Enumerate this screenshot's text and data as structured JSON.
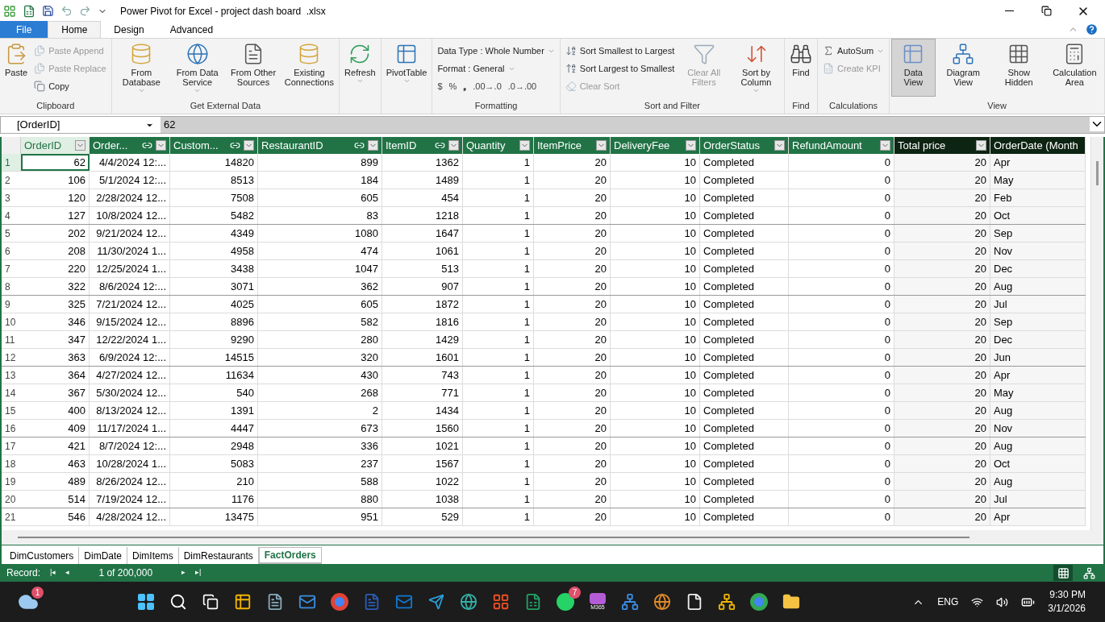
{
  "window": {
    "title": "Power Pivot for Excel - project dash board  .xlsx"
  },
  "ribbon_tabs": [
    {
      "label": "File",
      "kind": "file",
      "selected": false
    },
    {
      "label": "Home",
      "kind": "tab",
      "selected": true
    },
    {
      "label": "Design",
      "kind": "tab",
      "selected": false
    },
    {
      "label": "Advanced",
      "kind": "tab",
      "selected": false
    }
  ],
  "ribbon_groups": [
    {
      "label": "Clipboard",
      "items": [
        {
          "kind": "large",
          "label": "Paste",
          "disabled": false
        },
        {
          "kind": "stack",
          "items": [
            {
              "label": "Paste Append",
              "disabled": true
            },
            {
              "label": "Paste Replace",
              "disabled": true
            },
            {
              "label": "Copy",
              "disabled": false
            }
          ]
        }
      ]
    },
    {
      "label": "Get External Data",
      "items": [
        {
          "kind": "large",
          "label": "From Database",
          "dropdown": true,
          "disabled": false
        },
        {
          "kind": "large",
          "label": "From Data Service",
          "dropdown": true,
          "disabled": false
        },
        {
          "kind": "large",
          "label": "From Other Sources",
          "disabled": false
        },
        {
          "kind": "large",
          "label": "Existing Connections",
          "disabled": false
        }
      ]
    },
    {
      "items": [
        {
          "kind": "large",
          "label": "Refresh",
          "dropdown": true,
          "disabled": false
        }
      ]
    },
    {
      "items": [
        {
          "kind": "large",
          "label": "PivotTable",
          "dropdown": true,
          "disabled": false
        }
      ]
    },
    {
      "label": "Formatting",
      "items": [
        {
          "kind": "format",
          "data_type": "Data Type : Whole Number",
          "format": "Format : General",
          "symbols": [
            "$",
            "%",
            "❟",
            ".00→.0",
            ".0→.00"
          ]
        }
      ]
    },
    {
      "label": "Sort and Filter",
      "items": [
        {
          "kind": "stack",
          "items": [
            {
              "label": "Sort Smallest to Largest",
              "disabled": false
            },
            {
              "label": "Sort Largest to Smallest",
              "disabled": false
            },
            {
              "label": "Clear Sort",
              "disabled": true
            }
          ]
        },
        {
          "kind": "large",
          "label": "Clear All Filters",
          "disabled": true
        },
        {
          "kind": "large",
          "label": "Sort by Column",
          "dropdown": true,
          "disabled": false
        }
      ]
    },
    {
      "label": "Find",
      "items": [
        {
          "kind": "large",
          "label": "Find",
          "disabled": false
        }
      ]
    },
    {
      "label": "Calculations",
      "items": [
        {
          "kind": "stack",
          "items": [
            {
              "label": "AutoSum",
              "disabled": false,
              "dropdown": true
            },
            {
              "label": "Create KPI",
              "disabled": true
            }
          ]
        }
      ]
    },
    {
      "label": "View",
      "items": [
        {
          "kind": "large",
          "label": "Data View",
          "disabled": false,
          "selected": true
        },
        {
          "kind": "large",
          "label": "Diagram View",
          "disabled": false,
          "selected": false
        },
        {
          "kind": "large",
          "label": "Show Hidden",
          "disabled": false,
          "selected": false
        },
        {
          "kind": "large",
          "label": "Calculation Area",
          "disabled": false,
          "selected": false
        }
      ]
    }
  ],
  "formula_bar": {
    "name_box": "[OrderID]",
    "value": "62"
  },
  "table": {
    "columns": [
      {
        "label": "OrderID",
        "kind": "number",
        "selected": true,
        "linked": false,
        "calculated": false
      },
      {
        "label": "Order...",
        "kind": "number",
        "selected": false,
        "linked": true,
        "calculated": false
      },
      {
        "label": "Custom...",
        "kind": "number",
        "selected": false,
        "linked": true,
        "calculated": false
      },
      {
        "label": "RestaurantID",
        "kind": "number",
        "selected": false,
        "linked": true,
        "calculated": false
      },
      {
        "label": "ItemID",
        "kind": "number",
        "selected": false,
        "linked": true,
        "calculated": false
      },
      {
        "label": "Quantity",
        "kind": "number",
        "selected": false,
        "linked": false,
        "calculated": false
      },
      {
        "label": "ItemPrice",
        "kind": "number",
        "selected": false,
        "linked": false,
        "calculated": false
      },
      {
        "label": "DeliveryFee",
        "kind": "number",
        "selected": false,
        "linked": false,
        "calculated": false
      },
      {
        "label": "OrderStatus",
        "kind": "text",
        "selected": false,
        "linked": false,
        "calculated": false
      },
      {
        "label": "RefundAmount",
        "kind": "number",
        "selected": false,
        "linked": false,
        "calculated": false
      },
      {
        "label": "Total price",
        "kind": "number",
        "selected": false,
        "linked": false,
        "calculated": true
      },
      {
        "label": "OrderDate (Month",
        "kind": "text",
        "selected": false,
        "linked": false,
        "calculated": true
      }
    ],
    "rows": [
      {
        "num": "1",
        "cells": [
          "62",
          "4/4/2024 12:...",
          "14820",
          "899",
          "1362",
          "1",
          "20",
          "10",
          "Completed",
          "0",
          "20",
          "Apr"
        ]
      },
      {
        "num": "2",
        "cells": [
          "106",
          "5/1/2024 12:...",
          "8513",
          "184",
          "1489",
          "1",
          "20",
          "10",
          "Completed",
          "0",
          "20",
          "May"
        ]
      },
      {
        "num": "3",
        "cells": [
          "120",
          "2/28/2024 12...",
          "7508",
          "605",
          "454",
          "1",
          "20",
          "10",
          "Completed",
          "0",
          "20",
          "Feb"
        ]
      },
      {
        "num": "4",
        "cells": [
          "127",
          "10/8/2024 12...",
          "5482",
          "83",
          "1218",
          "1",
          "20",
          "10",
          "Completed",
          "0",
          "20",
          "Oct"
        ]
      },
      {
        "num": "5",
        "cells": [
          "202",
          "9/21/2024 12...",
          "4349",
          "1080",
          "1647",
          "1",
          "20",
          "10",
          "Completed",
          "0",
          "20",
          "Sep"
        ]
      },
      {
        "num": "6",
        "cells": [
          "208",
          "11/30/2024 1...",
          "4958",
          "474",
          "1061",
          "1",
          "20",
          "10",
          "Completed",
          "0",
          "20",
          "Nov"
        ]
      },
      {
        "num": "7",
        "cells": [
          "220",
          "12/25/2024 1...",
          "3438",
          "1047",
          "513",
          "1",
          "20",
          "10",
          "Completed",
          "0",
          "20",
          "Dec"
        ]
      },
      {
        "num": "8",
        "cells": [
          "322",
          "8/6/2024 12:...",
          "3071",
          "362",
          "907",
          "1",
          "20",
          "10",
          "Completed",
          "0",
          "20",
          "Aug"
        ]
      },
      {
        "num": "9",
        "cells": [
          "325",
          "7/21/2024 12...",
          "4025",
          "605",
          "1872",
          "1",
          "20",
          "10",
          "Completed",
          "0",
          "20",
          "Jul"
        ]
      },
      {
        "num": "10",
        "cells": [
          "346",
          "9/15/2024 12...",
          "8896",
          "582",
          "1816",
          "1",
          "20",
          "10",
          "Completed",
          "0",
          "20",
          "Sep"
        ]
      },
      {
        "num": "11",
        "cells": [
          "347",
          "12/22/2024 1...",
          "9290",
          "280",
          "1429",
          "1",
          "20",
          "10",
          "Completed",
          "0",
          "20",
          "Dec"
        ]
      },
      {
        "num": "12",
        "cells": [
          "363",
          "6/9/2024 12:...",
          "14515",
          "320",
          "1601",
          "1",
          "20",
          "10",
          "Completed",
          "0",
          "20",
          "Jun"
        ]
      },
      {
        "num": "13",
        "cells": [
          "364",
          "4/27/2024 12...",
          "11634",
          "430",
          "743",
          "1",
          "20",
          "10",
          "Completed",
          "0",
          "20",
          "Apr"
        ]
      },
      {
        "num": "14",
        "cells": [
          "367",
          "5/30/2024 12...",
          "540",
          "268",
          "771",
          "1",
          "20",
          "10",
          "Completed",
          "0",
          "20",
          "May"
        ]
      },
      {
        "num": "15",
        "cells": [
          "400",
          "8/13/2024 12...",
          "1391",
          "2",
          "1434",
          "1",
          "20",
          "10",
          "Completed",
          "0",
          "20",
          "Aug"
        ]
      },
      {
        "num": "16",
        "cells": [
          "409",
          "11/17/2024 1...",
          "4447",
          "673",
          "1560",
          "1",
          "20",
          "10",
          "Completed",
          "0",
          "20",
          "Nov"
        ]
      },
      {
        "num": "17",
        "cells": [
          "421",
          "8/7/2024 12:...",
          "2948",
          "336",
          "1021",
          "1",
          "20",
          "10",
          "Completed",
          "0",
          "20",
          "Aug"
        ]
      },
      {
        "num": "18",
        "cells": [
          "463",
          "10/28/2024 1...",
          "5083",
          "237",
          "1567",
          "1",
          "20",
          "10",
          "Completed",
          "0",
          "20",
          "Oct"
        ]
      },
      {
        "num": "19",
        "cells": [
          "489",
          "8/26/2024 12...",
          "210",
          "588",
          "1022",
          "1",
          "20",
          "10",
          "Completed",
          "0",
          "20",
          "Aug"
        ]
      },
      {
        "num": "20",
        "cells": [
          "514",
          "7/19/2024 12...",
          "1176",
          "880",
          "1038",
          "1",
          "20",
          "10",
          "Completed",
          "0",
          "20",
          "Jul"
        ]
      },
      {
        "num": "21",
        "cells": [
          "546",
          "4/28/2024 12...",
          "13475",
          "951",
          "529",
          "1",
          "20",
          "10",
          "Completed",
          "0",
          "20",
          "Apr"
        ]
      }
    ]
  },
  "sheet_tabs": [
    {
      "label": "DimCustomers",
      "selected": false
    },
    {
      "label": "DimDate",
      "selected": false
    },
    {
      "label": "DimItems",
      "selected": false
    },
    {
      "label": "DimRestaurants",
      "selected": false
    },
    {
      "label": "FactOrders",
      "selected": true
    }
  ],
  "status_bar": {
    "record_label": "Record:",
    "first": "|◂",
    "previous": "◂",
    "record": "1 of 200,000",
    "next": "▸",
    "last": "▸|",
    "grid_view_selected": true
  },
  "taskbar": {
    "weather_badge": "1",
    "whatsapp_badge": "7",
    "m365_label": "M365",
    "language": "ENG",
    "time": "9:30 PM",
    "date": "3/1/2026"
  }
}
